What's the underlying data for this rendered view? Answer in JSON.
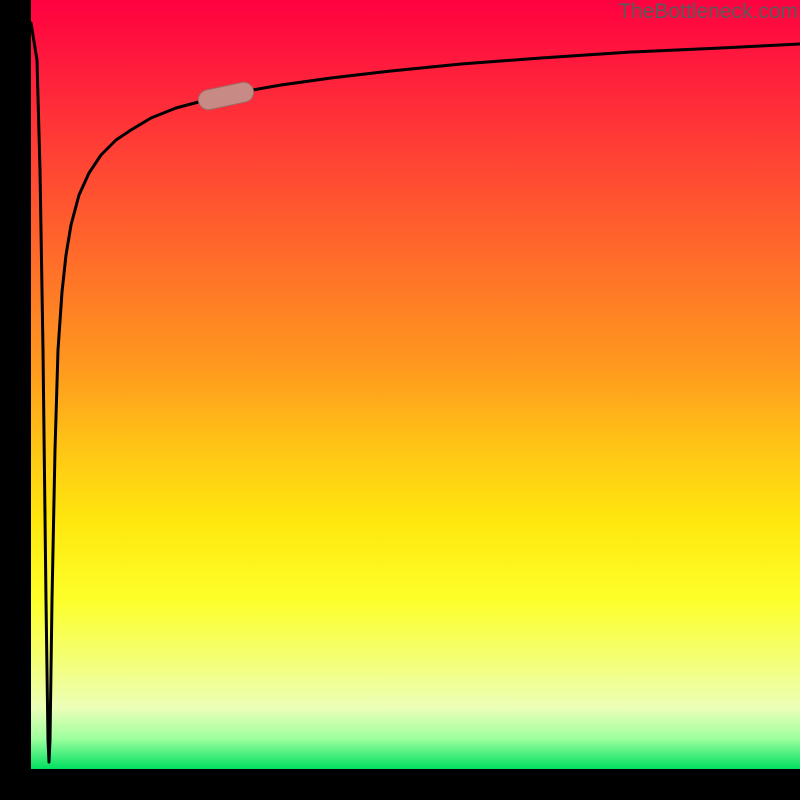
{
  "watermark": "TheBottleneck.com",
  "colors": {
    "gradient_top": "#ff0040",
    "gradient_mid1": "#ff7a26",
    "gradient_mid2": "#fdff2a",
    "gradient_bottom": "#00e060",
    "curve": "#000000",
    "marker_fill": "#c88a85",
    "marker_stroke": "#9e6a64",
    "background": "#000000"
  },
  "chart_data": {
    "type": "line",
    "title": "",
    "xlabel": "",
    "ylabel": "",
    "xlim": [
      0,
      100
    ],
    "ylim": [
      0,
      100
    ],
    "grid": false,
    "legend": false,
    "annotations": [
      "TheBottleneck.com"
    ],
    "comment": "Axes unlabeled in source image; values are normalized 0–100 read from pixel positions. Curve drawn as a single path: a vertical spike down near x≈2 to y≈0.5, then a log-like rise asymptoting near y≈95. Marker segment between x≈22 and x≈29 along the curve.",
    "series": [
      {
        "name": "curve",
        "x": [
          0.0,
          1.0,
          1.5,
          2.0,
          2.5,
          3.0,
          3.5,
          4.0,
          5.0,
          6.0,
          8.0,
          10.0,
          12.0,
          15.0,
          18.0,
          22.0,
          26.0,
          30.0,
          35.0,
          40.0,
          50.0,
          60.0,
          70.0,
          80.0,
          90.0,
          100.0
        ],
        "y": [
          97.0,
          70.0,
          40.0,
          0.5,
          30.0,
          50.0,
          60.0,
          65.0,
          70.0,
          73.5,
          77.5,
          80.0,
          82.0,
          84.0,
          85.3,
          86.5,
          87.5,
          88.3,
          89.2,
          90.0,
          91.3,
          92.3,
          93.0,
          93.6,
          94.1,
          94.5
        ]
      }
    ],
    "marker": {
      "shape": "pill",
      "along_series": "curve",
      "x_start": 22.0,
      "x_end": 29.0,
      "y_start": 86.5,
      "y_end": 88.1
    }
  }
}
